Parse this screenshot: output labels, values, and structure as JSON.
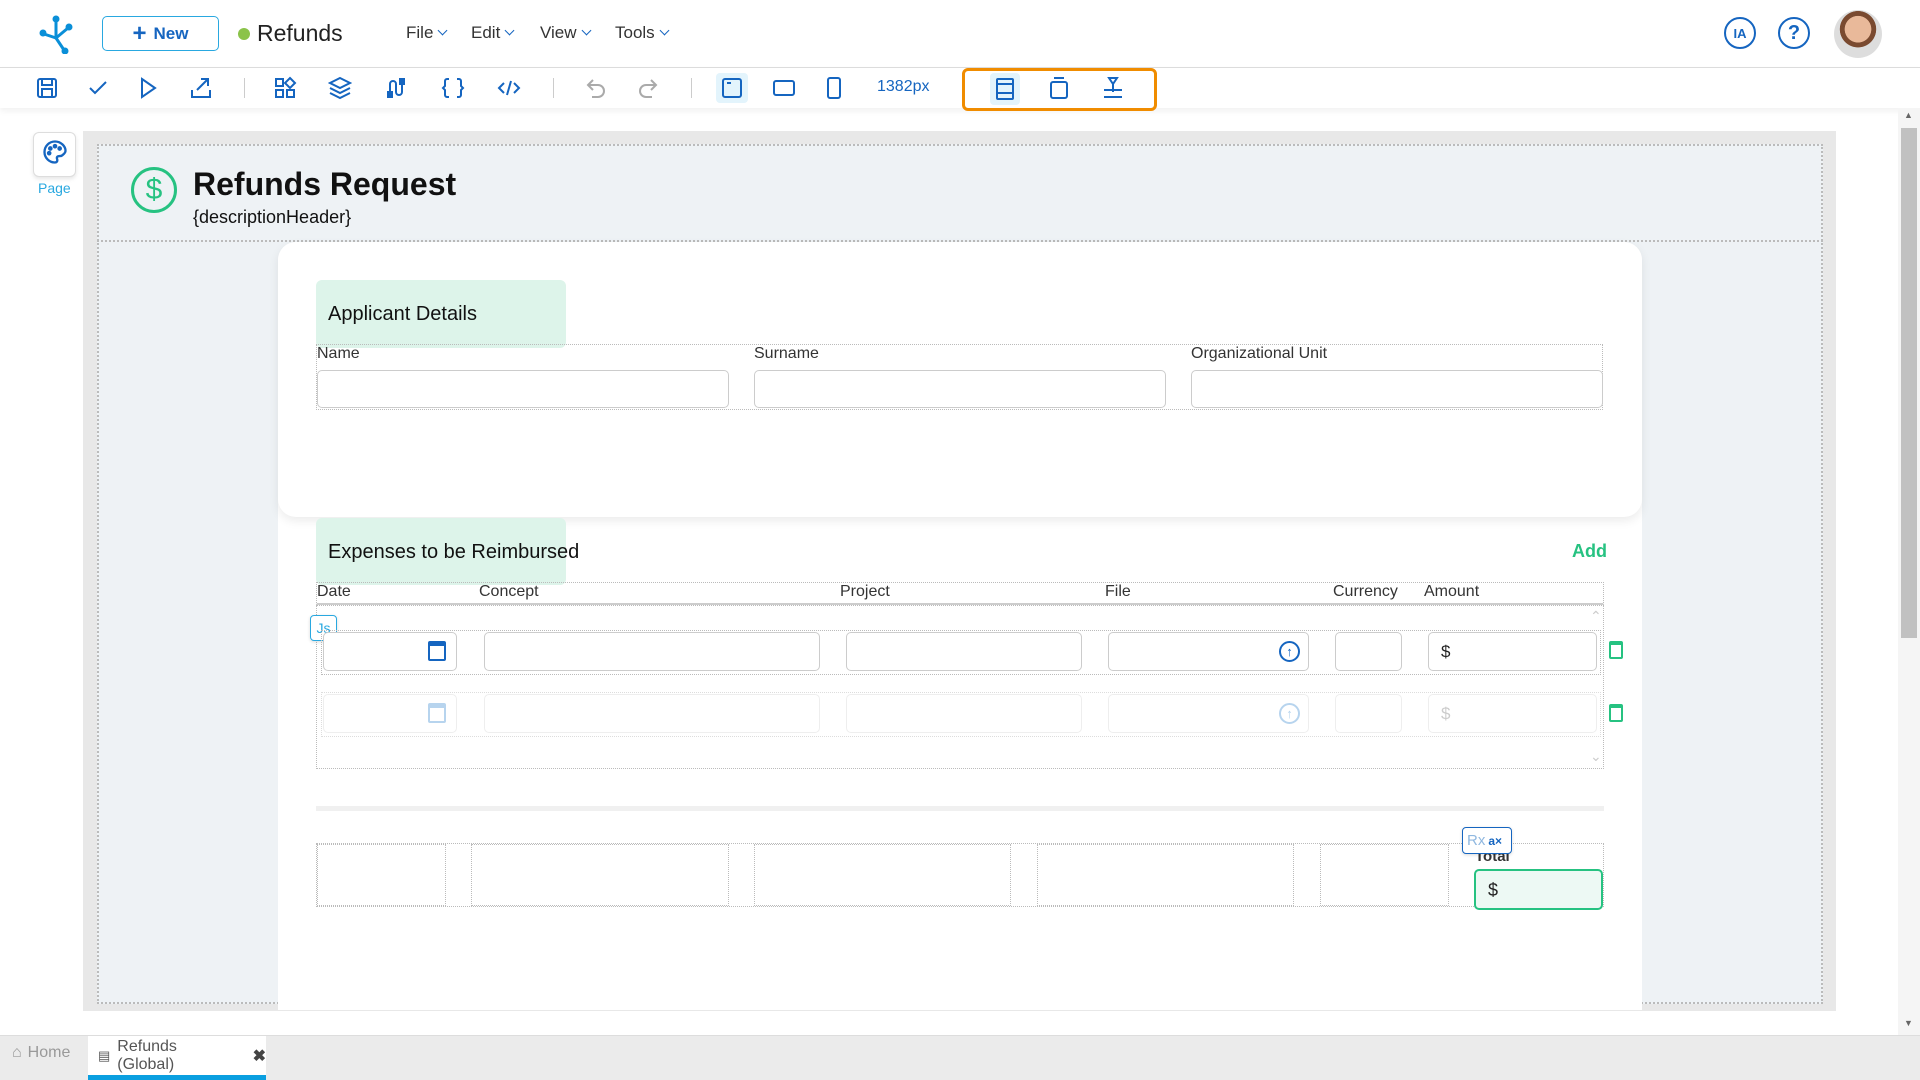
{
  "app": {
    "new_label": "New",
    "doc_title": "Refunds",
    "status_color": "#8bc34a",
    "menus": [
      "File",
      "Edit",
      "View",
      "Tools"
    ],
    "ia_label": "IA",
    "help_icon": "question-icon"
  },
  "toolbar": {
    "width_value": "1382px"
  },
  "sidebar": {
    "page_label": "Page"
  },
  "form": {
    "title": "Refunds Request",
    "description": "{descriptionHeader}",
    "applicant": {
      "heading": "Applicant Details",
      "fields": [
        "Name",
        "Surname",
        "Organizational Unit"
      ]
    },
    "expenses": {
      "heading": "Expenses to be Reimbursed",
      "add_label": "Add",
      "columns": [
        "Date",
        "Concept",
        "Project",
        "File",
        "Currency",
        "Amount"
      ],
      "currency_symbol": "$",
      "js_badge": "Js"
    },
    "totals": {
      "total_label": "Total",
      "total_value": "$",
      "rx_badge": "Rx"
    }
  },
  "tabs": [
    {
      "label": "Home"
    },
    {
      "label": "Refunds (Global)"
    }
  ],
  "colors": {
    "accent": "#1565c0",
    "green": "#26c281",
    "highlight": "#f08c00"
  }
}
